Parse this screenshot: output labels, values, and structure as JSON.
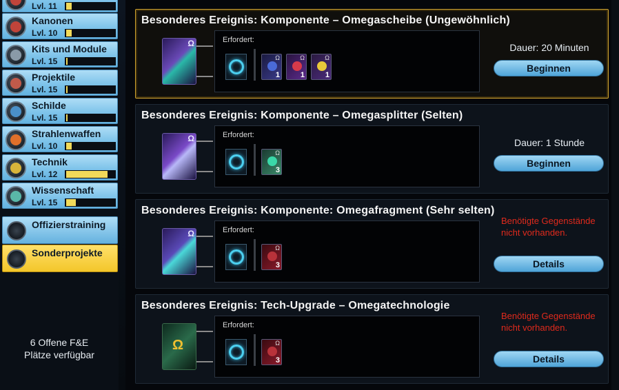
{
  "sidebar": {
    "skills": [
      {
        "name": "",
        "level": "Lvl. 11",
        "fill": 0.12
      },
      {
        "name": "Kanonen",
        "level": "Lvl. 10",
        "fill": 0.12
      },
      {
        "name": "Kits und Module",
        "level": "Lvl. 15",
        "fill": 0.02
      },
      {
        "name": "Projektile",
        "level": "Lvl. 15",
        "fill": 0.02
      },
      {
        "name": "Schilde",
        "level": "Lvl. 15",
        "fill": 0.02
      },
      {
        "name": "Strahlenwaffen",
        "level": "Lvl. 10",
        "fill": 0.12
      },
      {
        "name": "Technik",
        "level": "Lvl. 12",
        "fill": 0.85
      },
      {
        "name": "Wissenschaft",
        "level": "Lvl. 15",
        "fill": 0.2
      }
    ],
    "officer_training": "Offizierstraining",
    "special_projects": "Sonderprojekte",
    "slots_line1": "6 Offene F&E",
    "slots_line2": "Plätze verfügbar"
  },
  "projects": [
    {
      "title": "Besonderes Ereignis: Komponente – Omegascheibe (Ungewöhnlich)",
      "requires_label": "Erfordert:",
      "required_items": [
        {
          "count": "1",
          "color": "#4a6ad8"
        },
        {
          "count": "1",
          "color": "#d83a4a"
        },
        {
          "count": "1",
          "color": "#e8c83a"
        }
      ],
      "duration": "Dauer: 20 Minuten",
      "button": "Beginnen",
      "warning": ""
    },
    {
      "title": "Besonderes Ereignis: Komponente – Omegasplitter (Selten)",
      "requires_label": "Erfordert:",
      "required_items": [
        {
          "count": "3",
          "color": "#3ad8a8"
        }
      ],
      "duration": "Dauer: 1 Stunde",
      "button": "Beginnen",
      "warning": ""
    },
    {
      "title": "Besonderes Ereignis: Komponente: Omegafragment (Sehr selten)",
      "requires_label": "Erfordert:",
      "required_items": [
        {
          "count": "3",
          "color": "#b8323a"
        }
      ],
      "duration": "",
      "button": "Details",
      "warning": "Benötigte Gegenstände nicht vorhanden."
    },
    {
      "title": "Besonderes Ereignis: Tech-Upgrade – Omegatechnologie",
      "requires_label": "Erfordert:",
      "required_items": [
        {
          "count": "3",
          "color": "#b8323a"
        }
      ],
      "duration": "",
      "button": "Details",
      "warning": "Benötigte Gegenstände nicht vorhanden."
    }
  ],
  "icons": {
    "omega_symbol": "Ω",
    "skill_colors": [
      "#c0443a",
      "#c0443a",
      "#8a9aa8",
      "#c05a4a",
      "#4a90c8",
      "#e0702a",
      "#d8b43a",
      "#5ab8a8"
    ]
  }
}
